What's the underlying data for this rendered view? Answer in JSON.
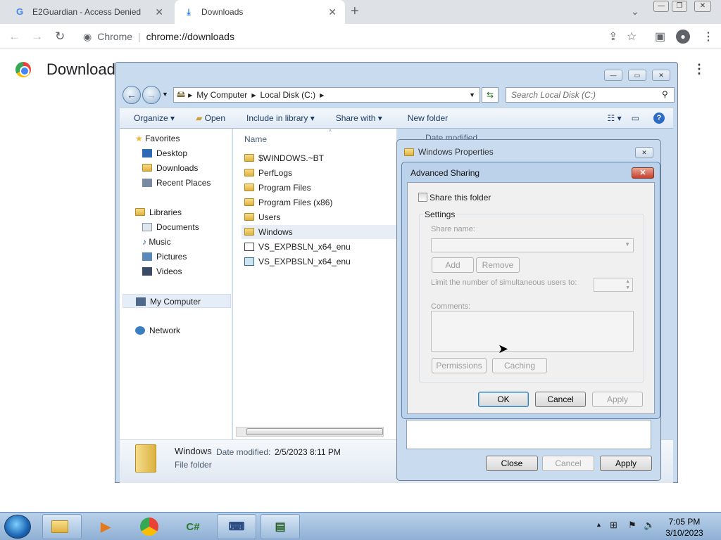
{
  "chrome": {
    "tabs": [
      {
        "title": "E2Guardian - Access Denied",
        "favicon": "G"
      },
      {
        "title": "Downloads",
        "favicon": "download-icon"
      }
    ],
    "new_tab": "+",
    "omnibox_label": "Chrome",
    "omnibox_url": "chrome://downloads",
    "page_title": "Downloads"
  },
  "explorer": {
    "breadcrumb": [
      "My Computer",
      "Local Disk (C:)"
    ],
    "search_placeholder": "Search Local Disk (C:)",
    "commands": {
      "organize": "Organize",
      "open": "Open",
      "include": "Include in library",
      "share": "Share with",
      "new_folder": "New folder"
    },
    "column_name": "Name",
    "column_date": "Date modified",
    "nav": {
      "favorites": "Favorites",
      "desktop": "Desktop",
      "downloads": "Downloads",
      "recent": "Recent Places",
      "libraries": "Libraries",
      "documents": "Documents",
      "music": "Music",
      "pictures": "Pictures",
      "videos": "Videos",
      "computer": "My Computer",
      "network": "Network"
    },
    "files": [
      "$WINDOWS.~BT",
      "PerfLogs",
      "Program Files",
      "Program Files (x86)",
      "Users",
      "Windows",
      "VS_EXPBSLN_x64_enu",
      "VS_EXPBSLN_x64_enu"
    ],
    "details": {
      "name": "Windows",
      "date_label": "Date modified:",
      "date_value": "2/5/2023 8:11 PM",
      "type": "File folder"
    }
  },
  "properties": {
    "title": "Windows Properties",
    "close": "Close",
    "cancel": "Cancel",
    "apply": "Apply"
  },
  "advanced": {
    "title": "Advanced Sharing",
    "share_checkbox": "Share this folder",
    "settings": "Settings",
    "share_name_label": "Share name:",
    "add": "Add",
    "remove": "Remove",
    "limit_label": "Limit the number of simultaneous users to:",
    "comments_label": "Comments:",
    "permissions": "Permissions",
    "caching": "Caching",
    "ok": "OK",
    "cancel": "Cancel",
    "apply": "Apply"
  },
  "taskbar": {
    "time": "7:05 PM",
    "date": "3/10/2023"
  }
}
